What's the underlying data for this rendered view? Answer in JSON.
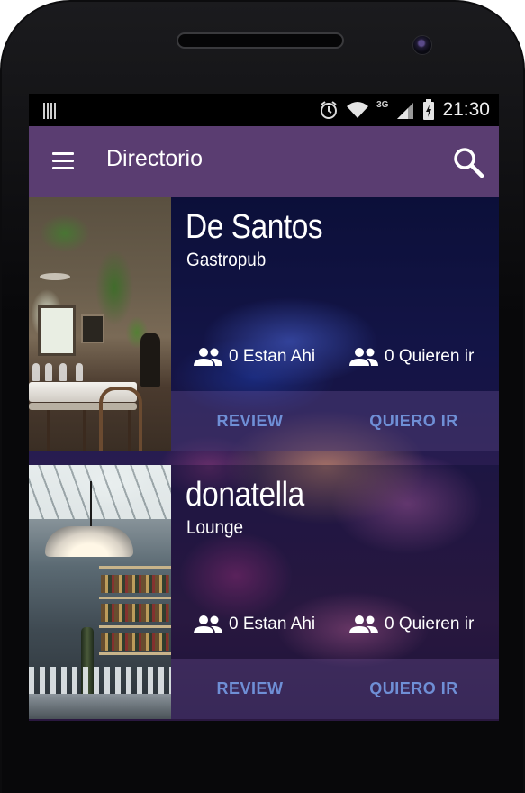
{
  "status_bar": {
    "network": "3G",
    "time": "21:30",
    "icons": [
      "notification-icon",
      "alarm-icon",
      "wifi-icon",
      "signal-icon",
      "battery-charging-icon"
    ]
  },
  "toolbar": {
    "title": "Directorio",
    "menu_icon": "hamburger-menu-icon",
    "search_icon": "search-icon",
    "background": "#5a3d71"
  },
  "venues": [
    {
      "name": "De Santos",
      "type": "Gastropub",
      "stat_there": "0 Estan Ahi",
      "stat_want": "0 Quieren ir",
      "review_label": "REVIEW",
      "want_label": "QUIERO IR"
    },
    {
      "name": "donatella",
      "type": "Lounge",
      "stat_there": "0 Estan Ahi",
      "stat_want": "0 Quieren ir",
      "review_label": "REVIEW",
      "want_label": "QUIERO IR"
    }
  ],
  "colors": {
    "accent_button_text": "#6f8fd6",
    "action_bar_bg": "#46376e"
  }
}
